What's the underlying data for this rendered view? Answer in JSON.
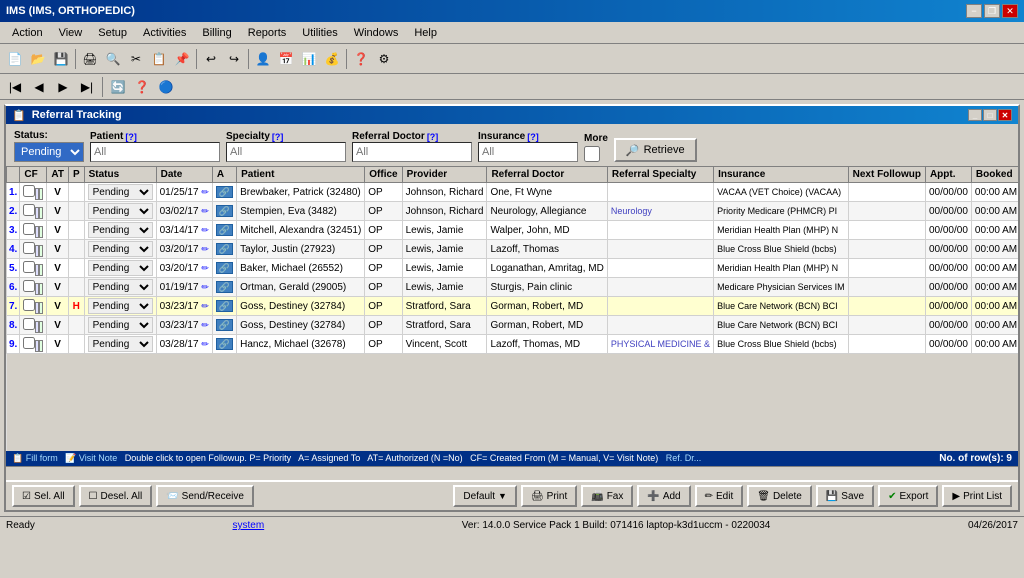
{
  "app": {
    "title": "IMS (IMS, ORTHOPEDIC)",
    "status": "Ready",
    "system_link": "system",
    "version_info": "Ver: 14.0.0 Service Pack 1   Build: 071416   laptop-k3d1uccm - 0220034",
    "date": "04/26/2017"
  },
  "menu": {
    "items": [
      "Action",
      "View",
      "Setup",
      "Activities",
      "Billing",
      "Reports",
      "Utilities",
      "Windows",
      "Help"
    ]
  },
  "window": {
    "title": "Referral Tracking"
  },
  "filters": {
    "status_label": "Status:",
    "status_value": "Pending",
    "patient_label": "Patient",
    "patient_placeholder": "All",
    "specialty_label": "Specialty",
    "specialty_placeholder": "All",
    "referral_doctor_label": "Referral Doctor",
    "referral_doctor_placeholder": "All",
    "insurance_label": "Insurance",
    "insurance_placeholder": "All",
    "more_label": "More",
    "retrieve_label": "Retrieve"
  },
  "table": {
    "columns": [
      "",
      "CF",
      "AT",
      "P",
      "Status",
      "Date",
      "A",
      "Patient",
      "Office",
      "Provider",
      "Referral Doctor",
      "Referral Specialty",
      "Insurance",
      "Next Followup",
      "Appt.",
      "Booked"
    ],
    "rows": [
      {
        "num": "1.",
        "cf": "",
        "at": "V",
        "p": "",
        "status": "Pending",
        "date": "01/25/17",
        "a": "",
        "patient": "Brewbaker, Patrick (32480)",
        "office": "OP",
        "provider": "Johnson, Richard",
        "referral_doctor": "One, Ft Wyne",
        "ref_specialty": "",
        "insurance": "VACAA (VET Choice)  (VACAA)",
        "next_followup": "",
        "appt": "00/00/00",
        "booked": "00:00 AM"
      },
      {
        "num": "2.",
        "cf": "",
        "at": "V",
        "p": "",
        "status": "Pending",
        "date": "03/02/17",
        "a": "",
        "patient": "Stempien, Eva (3482)",
        "office": "OP",
        "provider": "Johnson, Richard",
        "referral_doctor": "Neurology, Allegiance",
        "ref_specialty": "Neurology",
        "insurance": "Priority Medicare  (PHMCR)  PI",
        "next_followup": "",
        "appt": "00/00/00",
        "booked": "00:00 AM"
      },
      {
        "num": "3.",
        "cf": "",
        "at": "V",
        "p": "",
        "status": "Pending",
        "date": "03/14/17",
        "a": "",
        "patient": "Mitchell, Alexandra (32451)",
        "office": "OP",
        "provider": "Lewis, Jamie",
        "referral_doctor": "Walper, John, MD",
        "ref_specialty": "",
        "insurance": "Meridian Health Plan  (MHP)  N",
        "next_followup": "",
        "appt": "00/00/00",
        "booked": "00:00 AM"
      },
      {
        "num": "4.",
        "cf": "",
        "at": "V",
        "p": "",
        "status": "Pending",
        "date": "03/20/17",
        "a": "",
        "patient": "Taylor, Justin (27923)",
        "office": "OP",
        "provider": "Lewis, Jamie",
        "referral_doctor": "Lazoff, Thomas",
        "ref_specialty": "",
        "insurance": "Blue Cross Blue Shield  (bcbs)",
        "next_followup": "",
        "appt": "00/00/00",
        "booked": "00:00 AM"
      },
      {
        "num": "5.",
        "cf": "",
        "at": "V",
        "p": "",
        "status": "Pending",
        "date": "03/20/17",
        "a": "",
        "patient": "Baker, Michael (26552)",
        "office": "OP",
        "provider": "Lewis, Jamie",
        "referral_doctor": "Loganathan, Amritag, MD",
        "ref_specialty": "",
        "insurance": "Meridian Health Plan  (MHP)  N",
        "next_followup": "",
        "appt": "00/00/00",
        "booked": "00:00 AM"
      },
      {
        "num": "6.",
        "cf": "",
        "at": "V",
        "p": "",
        "status": "Pending",
        "date": "01/19/17",
        "a": "",
        "patient": "Ortman, Gerald (29005)",
        "office": "OP",
        "provider": "Lewis, Jamie",
        "referral_doctor": "Sturgis, Pain clinic",
        "ref_specialty": "",
        "insurance": "Medicare Physician Services  IM",
        "next_followup": "",
        "appt": "00/00/00",
        "booked": "00:00 AM"
      },
      {
        "num": "7.",
        "cf": "",
        "at": "V",
        "p": "H",
        "status": "Pending",
        "date": "03/23/17",
        "a": "",
        "patient": "Goss, Destiney (32784)",
        "office": "OP",
        "provider": "Stratford, Sara",
        "referral_doctor": "Gorman, Robert, MD",
        "ref_specialty": "",
        "insurance": "Blue Care Network  (BCN)  BCI",
        "next_followup": "",
        "appt": "00/00/00",
        "booked": "00:00 AM"
      },
      {
        "num": "8.",
        "cf": "",
        "at": "V",
        "p": "",
        "status": "Pending",
        "date": "03/23/17",
        "a": "",
        "patient": "Goss, Destiney (32784)",
        "office": "OP",
        "provider": "Stratford, Sara",
        "referral_doctor": "Gorman, Robert, MD",
        "ref_specialty": "",
        "insurance": "Blue Care Network  (BCN)  BCI",
        "next_followup": "",
        "appt": "00/00/00",
        "booked": "00:00 AM"
      },
      {
        "num": "9.",
        "cf": "",
        "at": "V",
        "p": "",
        "status": "Pending",
        "date": "03/28/17",
        "a": "",
        "patient": "Hancz, Michael (32678)",
        "office": "OP",
        "provider": "Vincent, Scott",
        "referral_doctor": "Lazoff, Thomas, MD",
        "ref_specialty": "PHYSICAL MEDICINE &",
        "insurance": "Blue Cross Blue Shield  (bcbs)",
        "next_followup": "",
        "appt": "00/00/00",
        "booked": "00:00 AM"
      }
    ],
    "row_count_label": "No. of row(s): 9"
  },
  "legend": {
    "text": "Fill form   Visit Note  Double click to open Followup. P= Priority  A= Assigned To  AT= Authorized (N =No)  CF= Created From (M = Manual, V= Visit Note)     Ref. Dr..."
  },
  "bottom_toolbar": {
    "sel_all": "Sel. All",
    "desel_all": "Desel. All",
    "send_receive": "Send/Receive",
    "default": "Default",
    "print": "Print",
    "fax": "Fax",
    "add": "Add",
    "edit": "Edit",
    "delete": "Delete",
    "save": "Save",
    "export": "Export",
    "print_list": "Print List"
  },
  "colors": {
    "title_bar_start": "#003087",
    "title_bar_end": "#1084d0",
    "retrieve_bg": "#d4d0c8",
    "pending_bg": "#316ac5",
    "pending_color": "white"
  }
}
